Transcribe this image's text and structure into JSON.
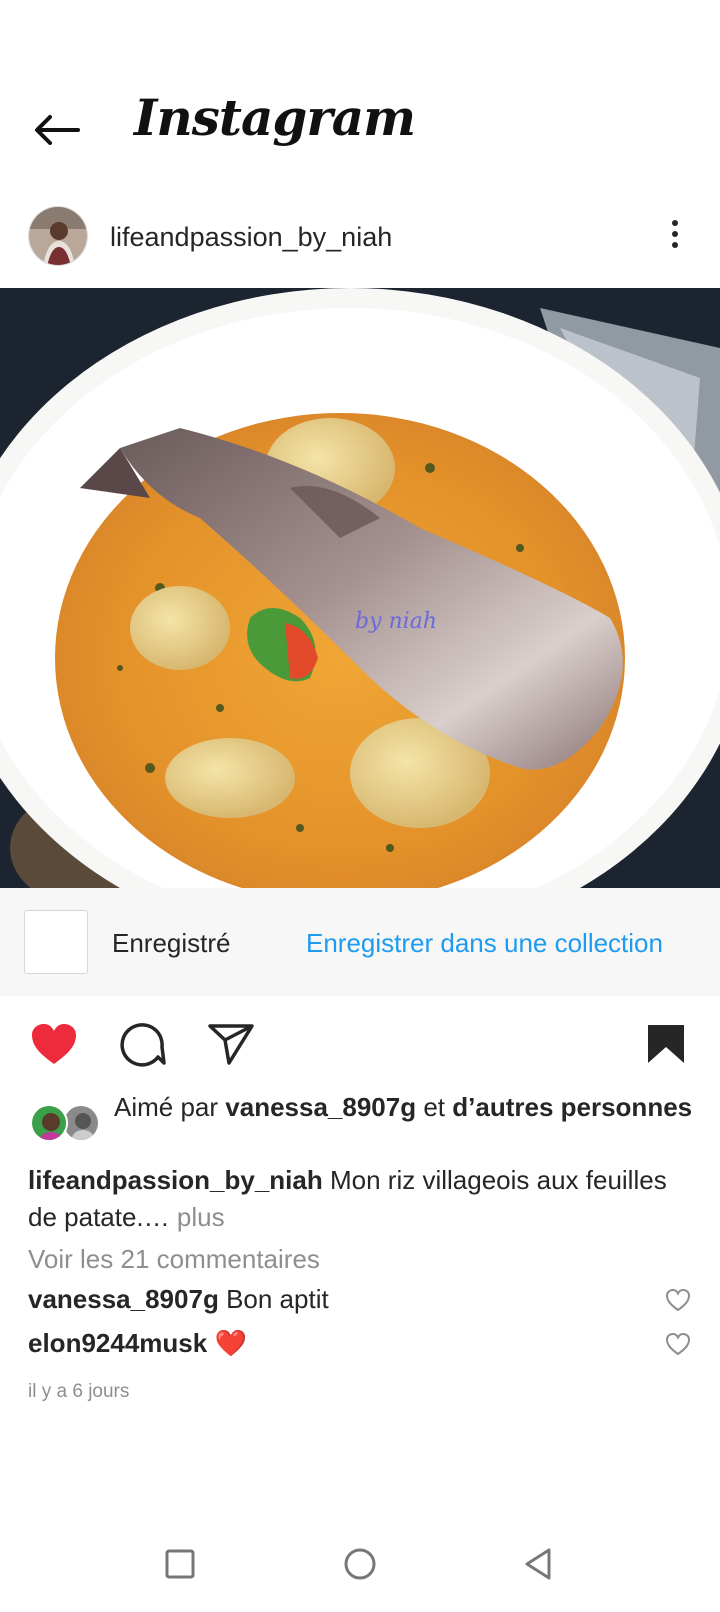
{
  "app": {
    "title": "Instagram",
    "back_icon": "arrow-left-icon"
  },
  "post": {
    "username": "lifeandpassion_by_niah",
    "more_icon": "more-vertical-icon",
    "image_watermark": "by niah"
  },
  "save_bar": {
    "saved_label": "Enregistré",
    "collection_link": "Enregistrer dans une collection",
    "link_color": "#1d9bf0"
  },
  "actions": {
    "like_icon": "heart-filled-icon",
    "liked": true,
    "like_color": "#ed2b3d",
    "comment_icon": "comment-icon",
    "share_icon": "send-icon",
    "save_icon": "bookmark-filled-icon",
    "saved": true
  },
  "likes": {
    "prefix": "Aimé par",
    "first_liker": "vanessa_8907g",
    "connector": "et",
    "others": "d’autres personnes"
  },
  "caption": {
    "username": "lifeandpassion_by_niah",
    "text": "Mon riz villageois aux feuilles de patate.…",
    "more": "plus"
  },
  "comments": {
    "view_all": "Voir les 21 commentaires",
    "items": [
      {
        "username": "vanessa_8907g",
        "text": "Bon aptit"
      },
      {
        "username": "elon9244musk",
        "text": "❤️"
      }
    ]
  },
  "timestamp": "il y a 6 jours",
  "system_nav": {
    "recents_icon": "square-icon",
    "home_icon": "circle-icon",
    "back_icon": "triangle-back-icon"
  }
}
